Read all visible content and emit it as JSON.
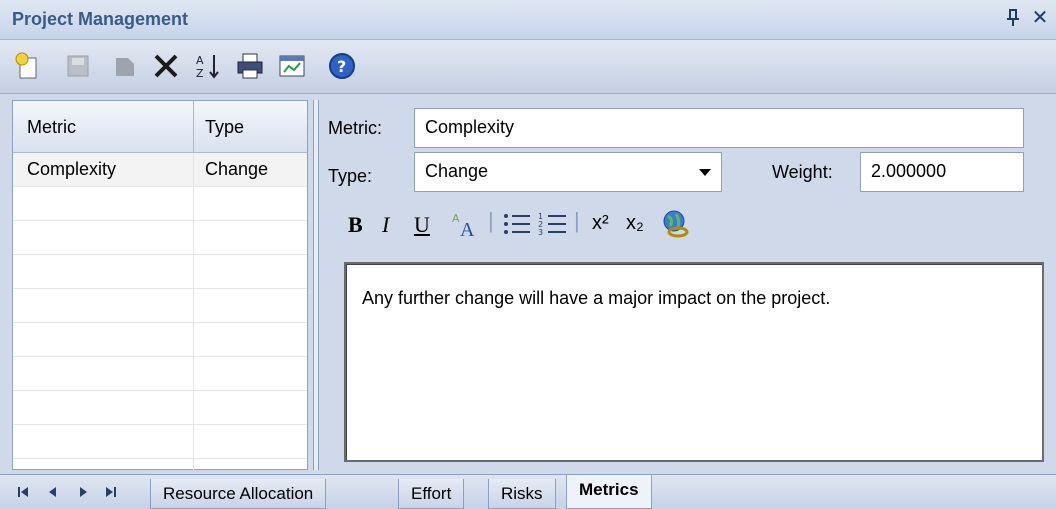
{
  "window": {
    "title": "Project Management",
    "pin_glyph": "⊥",
    "close_glyph": "✕"
  },
  "toolbar": {
    "icons": [
      "new-icon",
      "save-icon",
      "copy-icon",
      "delete-icon",
      "sort-icon",
      "print-icon",
      "report-icon",
      "help-icon"
    ]
  },
  "grid": {
    "columns": [
      "Metric",
      "Type"
    ],
    "rows": [
      {
        "metric": "Complexity",
        "type": "Change"
      }
    ]
  },
  "form": {
    "metric_label": "Metric:",
    "metric_value": "Complexity",
    "type_label": "Type:",
    "type_value": "Change",
    "weight_label": "Weight:",
    "weight_value": "2.000000"
  },
  "format_toolbar": {
    "bold": "B",
    "italic": "I",
    "underline": "U",
    "superscript": "x²",
    "subscript": "x₂"
  },
  "editor": {
    "text": "Any further change will have a major impact on the project."
  },
  "tabs": {
    "items": [
      "Resource Allocation",
      "Effort",
      "Risks",
      "Metrics"
    ],
    "active": "Metrics"
  },
  "colors": {
    "title_text": "#3a5a8c",
    "panel_bg": "#cfd9ea",
    "border": "#8da0c0"
  }
}
